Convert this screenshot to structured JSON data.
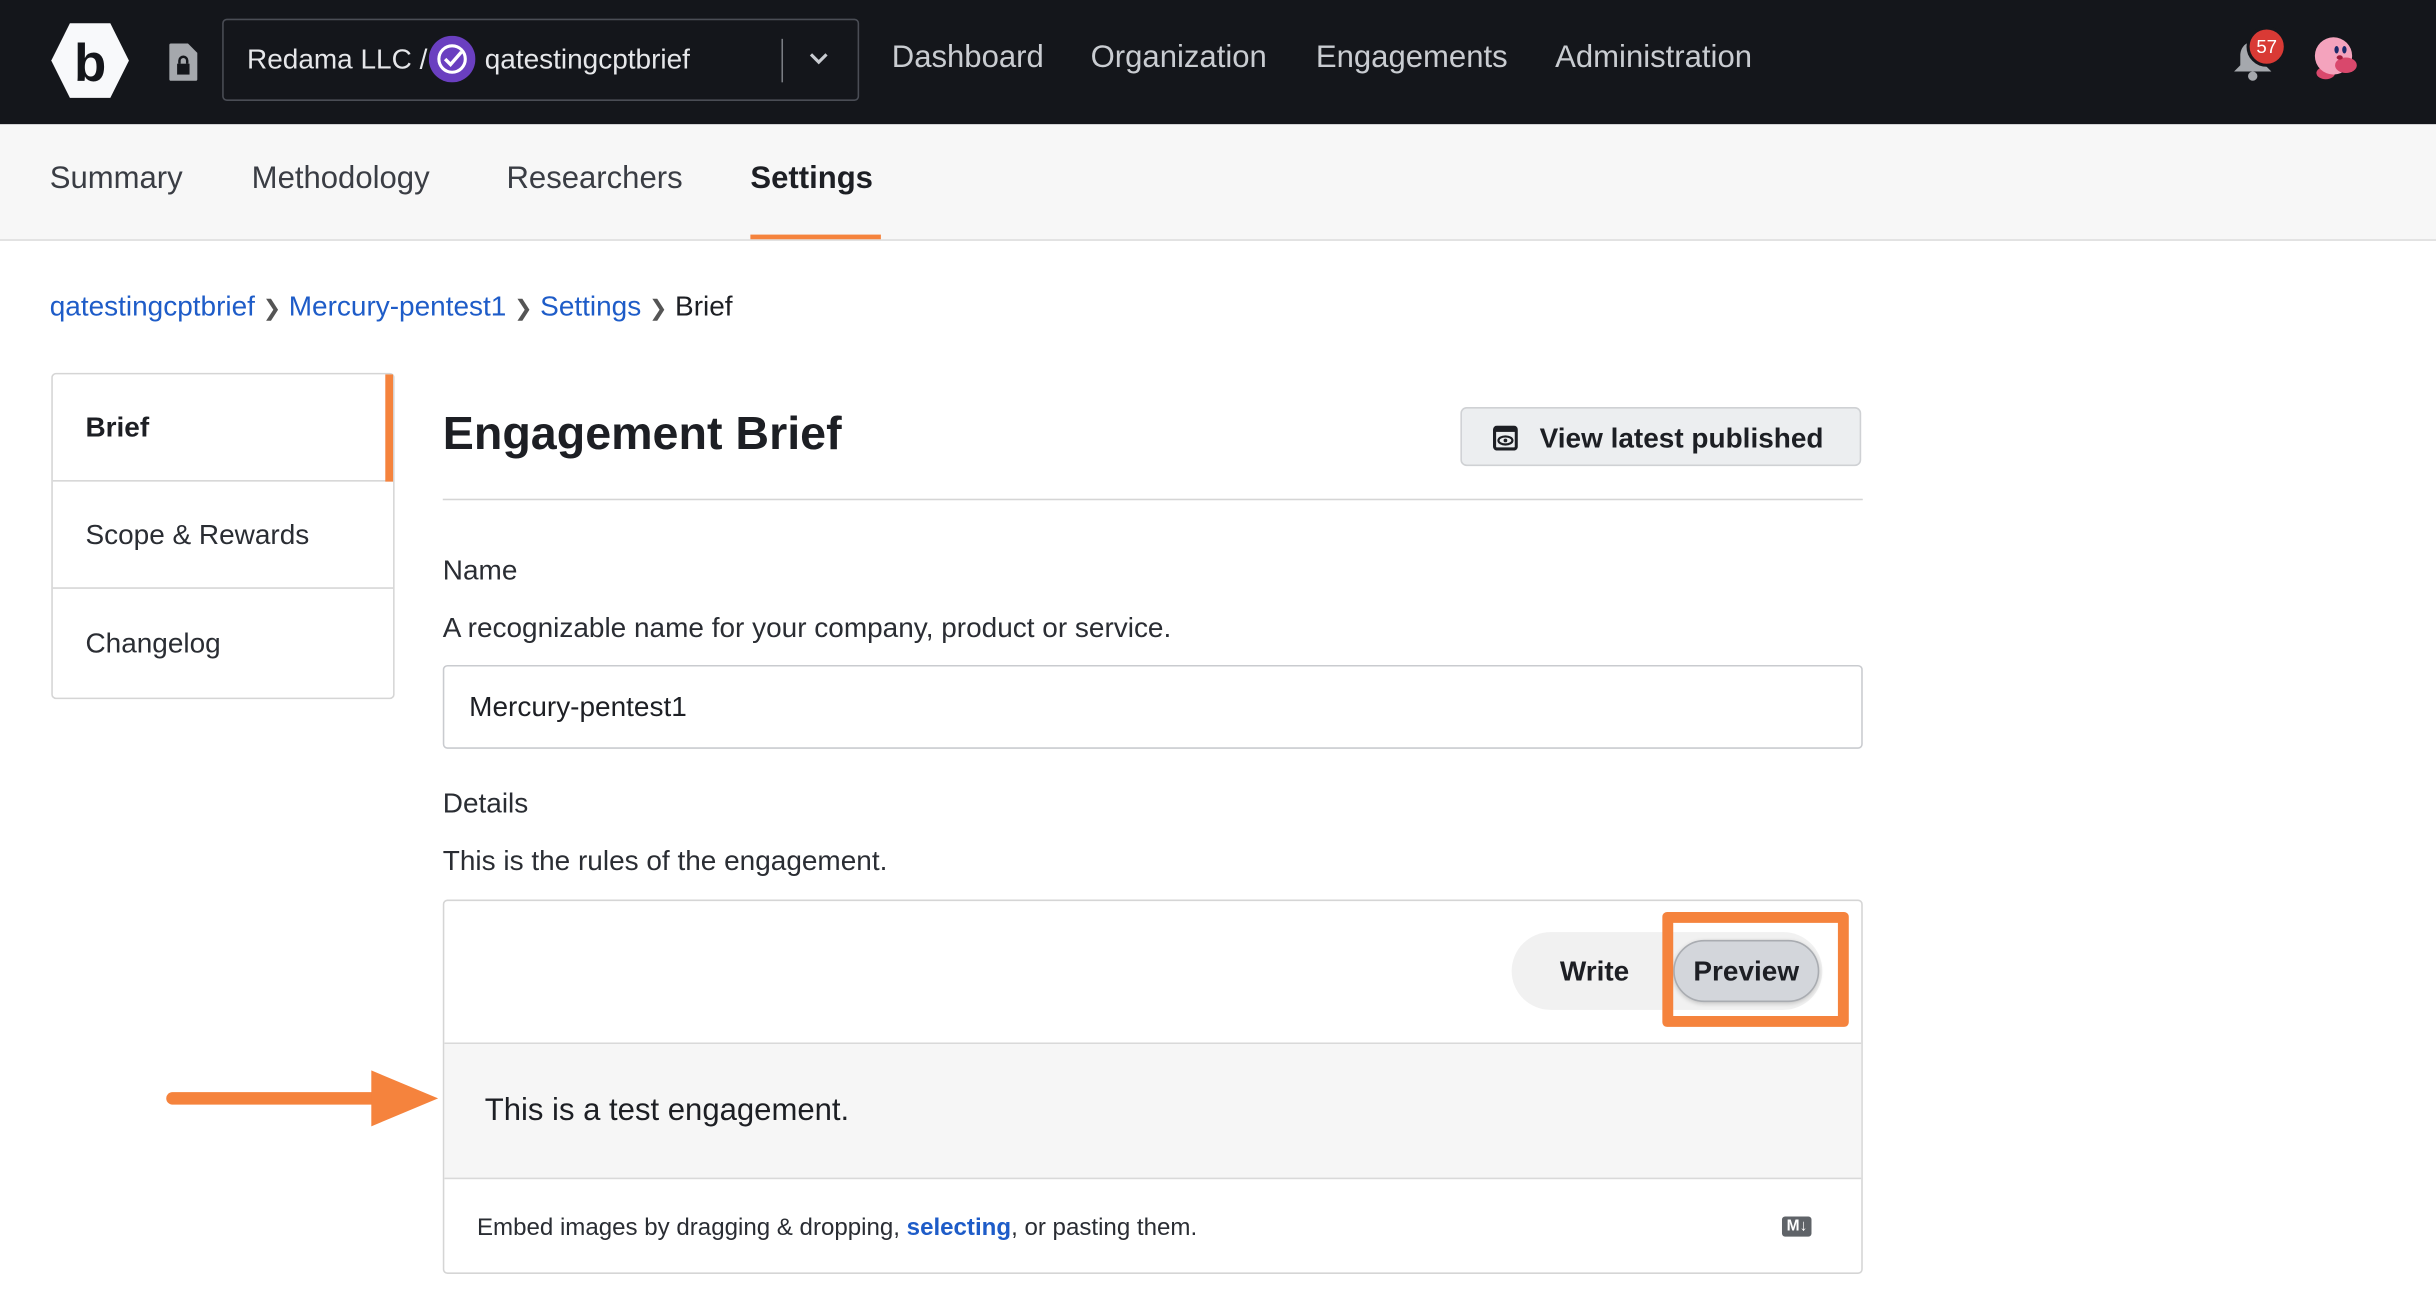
{
  "topnav": {
    "org": "Redama LLC /",
    "program": "qatestingcptbrief",
    "links": [
      "Dashboard",
      "Organization",
      "Engagements",
      "Administration"
    ],
    "notifications": "57",
    "icons": {
      "logo": "bugcrowd-hex-logo",
      "doc": "locked-document-icon",
      "program": "verified-check-icon",
      "chevron": "chevron-down-icon",
      "bell": "bell-icon",
      "avatar": "kirby-avatar"
    }
  },
  "tabs": [
    {
      "label": "Summary"
    },
    {
      "label": "Methodology"
    },
    {
      "label": "Researchers"
    },
    {
      "label": "Settings",
      "active": true
    }
  ],
  "breadcrumb": [
    "qatestingcptbrief",
    "Mercury-pentest1",
    "Settings",
    "Brief"
  ],
  "sidebar": {
    "items": [
      "Brief",
      "Scope & Rewards",
      "Changelog"
    ],
    "active": "Brief"
  },
  "main": {
    "title": "Engagement Brief",
    "view_button": "View latest published",
    "name_label": "Name",
    "name_help": "A recognizable name for your company, product or service.",
    "name_value": "Mercury-pentest1",
    "details_label": "Details",
    "details_help": "This is the rules of the engagement.",
    "write": "Write",
    "preview": "Preview",
    "preview_text": "This is a test engagement.",
    "footer_pre": "Embed images by dragging & dropping, ",
    "footer_link": "selecting",
    "footer_post": ", or pasting them.",
    "md_badge": "M↓"
  },
  "colors": {
    "accent": "#f5833d",
    "nav_bg": "#14161b",
    "link": "#1e5cc8",
    "badge": "#d93a35",
    "program": "#6a3fc0"
  }
}
